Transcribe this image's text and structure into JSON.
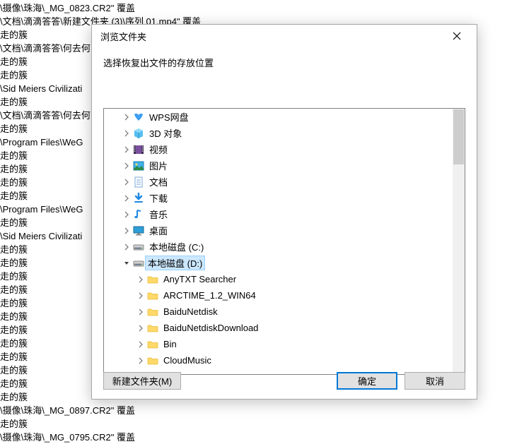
{
  "background_rows": [
    "\\摄像\\珠海\\_MG_0823.CR2\" 覆盖",
    "\\文档\\滴滴答答\\新建文件夹 (3)\\序列 01.mp4\" 覆盖",
    "走的簇",
    "\\文档\\滴滴答答\\何去何",
    "走的簇",
    "走的簇",
    "\\Sid Meiers Civilizati",
    "走的簇",
    "\\文档\\滴滴答答\\何去何",
    "走的簇",
    "\\Program Files\\WeG",
    "走的簇",
    "走的簇",
    "走的簇",
    "走的簇",
    "\\Program Files\\WeG",
    "走的簇",
    "\\Sid Meiers Civilizati",
    "走的簇",
    "走的簇",
    "走的簇",
    "走的簇",
    "走的簇",
    "走的簇",
    "走的簇",
    "走的簇",
    "走的簇",
    "走的簇",
    "走的簇",
    "走的簇",
    "\\摄像\\珠海\\_MG_0897.CR2\" 覆盖",
    "走的簇",
    "\\摄像\\珠海\\_MG_0795.CR2\" 覆盖"
  ],
  "dialog": {
    "title": "浏览文件夹",
    "instruction": "选择恢复出文件的存放位置",
    "buttons": {
      "new_folder": "新建文件夹(M)",
      "ok": "确定",
      "cancel": "取消"
    }
  },
  "tree": [
    {
      "indent": 1,
      "exp": "closed",
      "icon": "wps",
      "label": "WPS网盘"
    },
    {
      "indent": 1,
      "exp": "closed",
      "icon": "cube",
      "label": "3D 对象"
    },
    {
      "indent": 1,
      "exp": "closed",
      "icon": "video",
      "label": "视频"
    },
    {
      "indent": 1,
      "exp": "closed",
      "icon": "pic",
      "label": "图片"
    },
    {
      "indent": 1,
      "exp": "closed",
      "icon": "doc",
      "label": "文档"
    },
    {
      "indent": 1,
      "exp": "closed",
      "icon": "down",
      "label": "下载"
    },
    {
      "indent": 1,
      "exp": "closed",
      "icon": "music",
      "label": "音乐"
    },
    {
      "indent": 1,
      "exp": "closed",
      "icon": "desk",
      "label": "桌面"
    },
    {
      "indent": 1,
      "exp": "closed",
      "icon": "disk",
      "label": "本地磁盘 (C:)"
    },
    {
      "indent": 1,
      "exp": "open",
      "icon": "disk",
      "label": "本地磁盘 (D:)",
      "selected": true
    },
    {
      "indent": 2,
      "exp": "closed",
      "icon": "folder",
      "label": "AnyTXT Searcher"
    },
    {
      "indent": 2,
      "exp": "closed",
      "icon": "folder",
      "label": "ARCTIME_1.2_WIN64"
    },
    {
      "indent": 2,
      "exp": "closed",
      "icon": "folder",
      "label": "BaiduNetdisk"
    },
    {
      "indent": 2,
      "exp": "closed",
      "icon": "folder",
      "label": "BaiduNetdiskDownload"
    },
    {
      "indent": 2,
      "exp": "closed",
      "icon": "folder",
      "label": "Bin"
    },
    {
      "indent": 2,
      "exp": "closed",
      "icon": "folder",
      "label": "CloudMusic"
    }
  ]
}
